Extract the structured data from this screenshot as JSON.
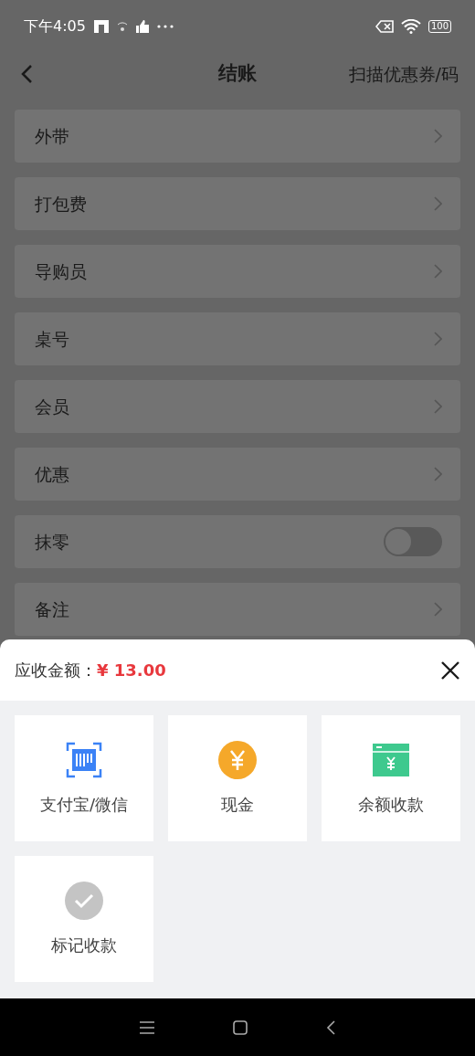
{
  "status_bar": {
    "time": "下午4:05",
    "battery": "100"
  },
  "header": {
    "title": "结账",
    "action": "扫描优惠券/码"
  },
  "rows": [
    {
      "label": "外带",
      "kind": "arrow"
    },
    {
      "label": "打包费",
      "kind": "arrow"
    },
    {
      "label": "导购员",
      "kind": "arrow"
    },
    {
      "label": "桌号",
      "kind": "arrow"
    },
    {
      "label": "会员",
      "kind": "arrow"
    },
    {
      "label": "优惠",
      "kind": "arrow"
    },
    {
      "label": "抹零",
      "kind": "toggle",
      "on": false
    },
    {
      "label": "备注",
      "kind": "arrow"
    }
  ],
  "sheet": {
    "amount_label": "应收金额：",
    "amount": "¥ 13.00",
    "methods": [
      {
        "label": "支付宝/微信",
        "kind": "scan"
      },
      {
        "label": "现金",
        "kind": "cash"
      },
      {
        "label": "余额收款",
        "kind": "balance"
      },
      {
        "label": "标记收款",
        "kind": "mark"
      }
    ]
  }
}
